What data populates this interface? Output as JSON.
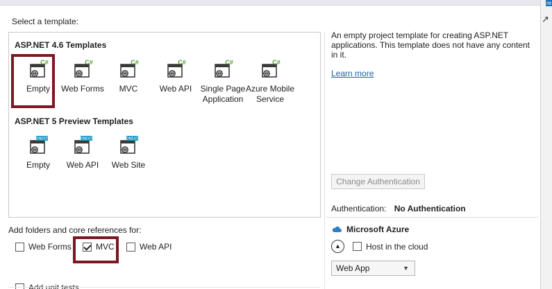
{
  "dialog": {
    "select_template_label": "Select a template:",
    "edge_tab_label": "re"
  },
  "templates": {
    "group1": {
      "title": "ASP.NET 4.6 Templates",
      "items": [
        {
          "label": "Empty",
          "badge": "C#",
          "icon": "aspnet-csharp-project-icon",
          "selected": true
        },
        {
          "label": "Web Forms",
          "badge": "C#",
          "icon": "aspnet-csharp-project-icon"
        },
        {
          "label": "MVC",
          "badge": "C#",
          "icon": "aspnet-csharp-project-icon"
        },
        {
          "label": "Web API",
          "badge": "C#",
          "icon": "aspnet-csharp-project-icon"
        },
        {
          "label": "Single Page\nApplication",
          "badge": "C#",
          "icon": "aspnet-csharp-project-icon"
        },
        {
          "label": "Azure Mobile\nService",
          "badge": "C#",
          "icon": "aspnet-csharp-project-icon"
        }
      ]
    },
    "group2": {
      "title": "ASP.NET 5 Preview Templates",
      "items": [
        {
          "label": "Empty",
          "badge": "DNEXT",
          "icon": "aspnet-5-project-icon"
        },
        {
          "label": "Web API",
          "badge": "DNEXT",
          "icon": "aspnet-5-project-icon"
        },
        {
          "label": "Web Site",
          "badge": "DNEXT",
          "icon": "aspnet-5-project-icon"
        }
      ]
    }
  },
  "references": {
    "label": "Add folders and core references for:",
    "options": [
      {
        "label": "Web Forms",
        "checked": false
      },
      {
        "label": "MVC",
        "checked": true
      },
      {
        "label": "Web API",
        "checked": false
      }
    ],
    "unit_tests_label": "Add unit tests"
  },
  "details": {
    "description": "An empty project template for creating ASP.NET applications. This template does not have any content in it.",
    "learn_more": "Learn more",
    "change_auth_button": "Change Authentication",
    "auth_label": "Authentication:",
    "auth_value": "No Authentication",
    "azure_title": "Microsoft Azure",
    "host_in_cloud_label": "Host in the cloud",
    "host_in_cloud_checked": false,
    "hosting_type": "Web App"
  },
  "colors": {
    "highlight": "#7b1720",
    "link": "#1f5fa8",
    "csharp_badge": "#4d9a2c",
    "dnext_badge": "#1a9bc6",
    "azure_blue": "#2f7fc1"
  }
}
